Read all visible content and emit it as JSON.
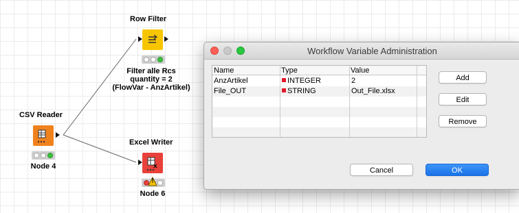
{
  "workflow": {
    "nodes": {
      "csv_reader": {
        "title": "CSV Reader",
        "label": "Node 4",
        "color": "#f0821e"
      },
      "row_filter": {
        "title": "Row Filter",
        "label_lines": [
          "Filter alle Rcs",
          "quantity = 2",
          "(FlowVar - AnzArtikel)"
        ],
        "color": "#f7c600"
      },
      "excel_writer": {
        "title": "Excel Writer",
        "label": "Node 6",
        "color": "#e8413a",
        "status_warning": "!"
      }
    }
  },
  "dialog": {
    "title": "Workflow Variable Administration",
    "table": {
      "headers": [
        "Name",
        "Type",
        "Value"
      ],
      "rows": [
        {
          "name": "AnzArtikel",
          "type": "INTEGER",
          "value": "2",
          "type_color": "#e0192b"
        },
        {
          "name": "File_OUT",
          "type": "STRING",
          "value": "Out_File.xlsx",
          "type_color": "#e0192b"
        }
      ]
    },
    "buttons": {
      "add": "Add",
      "edit": "Edit",
      "remove": "Remove",
      "cancel": "Cancel",
      "ok": "OK"
    }
  }
}
